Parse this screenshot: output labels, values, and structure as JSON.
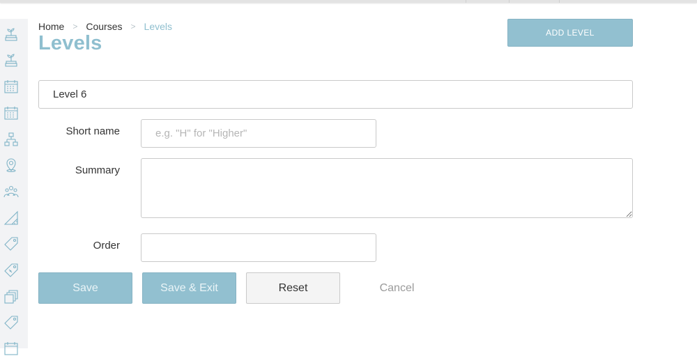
{
  "breadcrumb": {
    "home": "Home",
    "courses": "Courses",
    "current": "Levels",
    "separator": ">"
  },
  "page": {
    "title": "Levels",
    "add_button": "ADD LEVEL"
  },
  "form": {
    "name_value": "Level 6",
    "short_name_label": "Short name",
    "short_name_placeholder": "e.g. \"H\" for \"Higher\"",
    "summary_label": "Summary",
    "summary_value": "",
    "order_label": "Order",
    "order_value": ""
  },
  "actions": {
    "save": "Save",
    "save_exit": "Save & Exit",
    "reset": "Reset",
    "cancel": "Cancel"
  },
  "sidebar": {
    "icons": [
      "plant-icon",
      "plant-icon",
      "calendar-icon",
      "calendar-icon",
      "hierarchy-icon",
      "location-pin-icon",
      "people-group-icon",
      "ruler-triangle-icon",
      "tag-icon",
      "money-tag-icon",
      "stack-icon",
      "tag-icon",
      "calendar-icon"
    ]
  },
  "colors": {
    "accent": "#8fbfcf",
    "button": "#92c0d0",
    "sidebar_bg": "#f2f3f5"
  }
}
